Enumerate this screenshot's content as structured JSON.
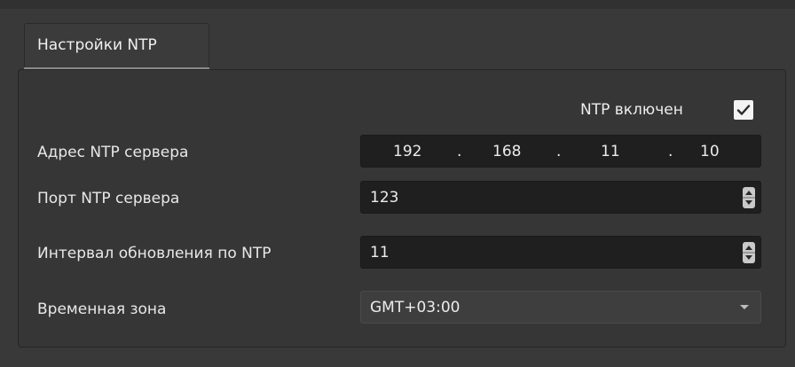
{
  "tab": {
    "label": "Настройки NTP"
  },
  "ntp_enabled": {
    "label": "NTP включен",
    "checked": true
  },
  "server_address": {
    "label": "Адрес NTP сервера",
    "octets": [
      "192",
      "168",
      "11",
      "10"
    ],
    "separator": "."
  },
  "server_port": {
    "label": "Порт NTP сервера",
    "value": "123"
  },
  "update_interval": {
    "label": "Интервал обновления по NTP",
    "value": "11"
  },
  "timezone": {
    "label": "Временная зона",
    "value": "GMT+03:00"
  },
  "colors": {
    "background": "#393939",
    "field_bg": "#1f1f1f",
    "combo_bg": "#3e3e3e",
    "text": "#e8e8e8",
    "checkbox": "#f4f4f4"
  },
  "icons": {
    "checkmark": "check-icon",
    "spin": "spin-arrows-icon",
    "dropdown": "chevron-down-icon"
  }
}
